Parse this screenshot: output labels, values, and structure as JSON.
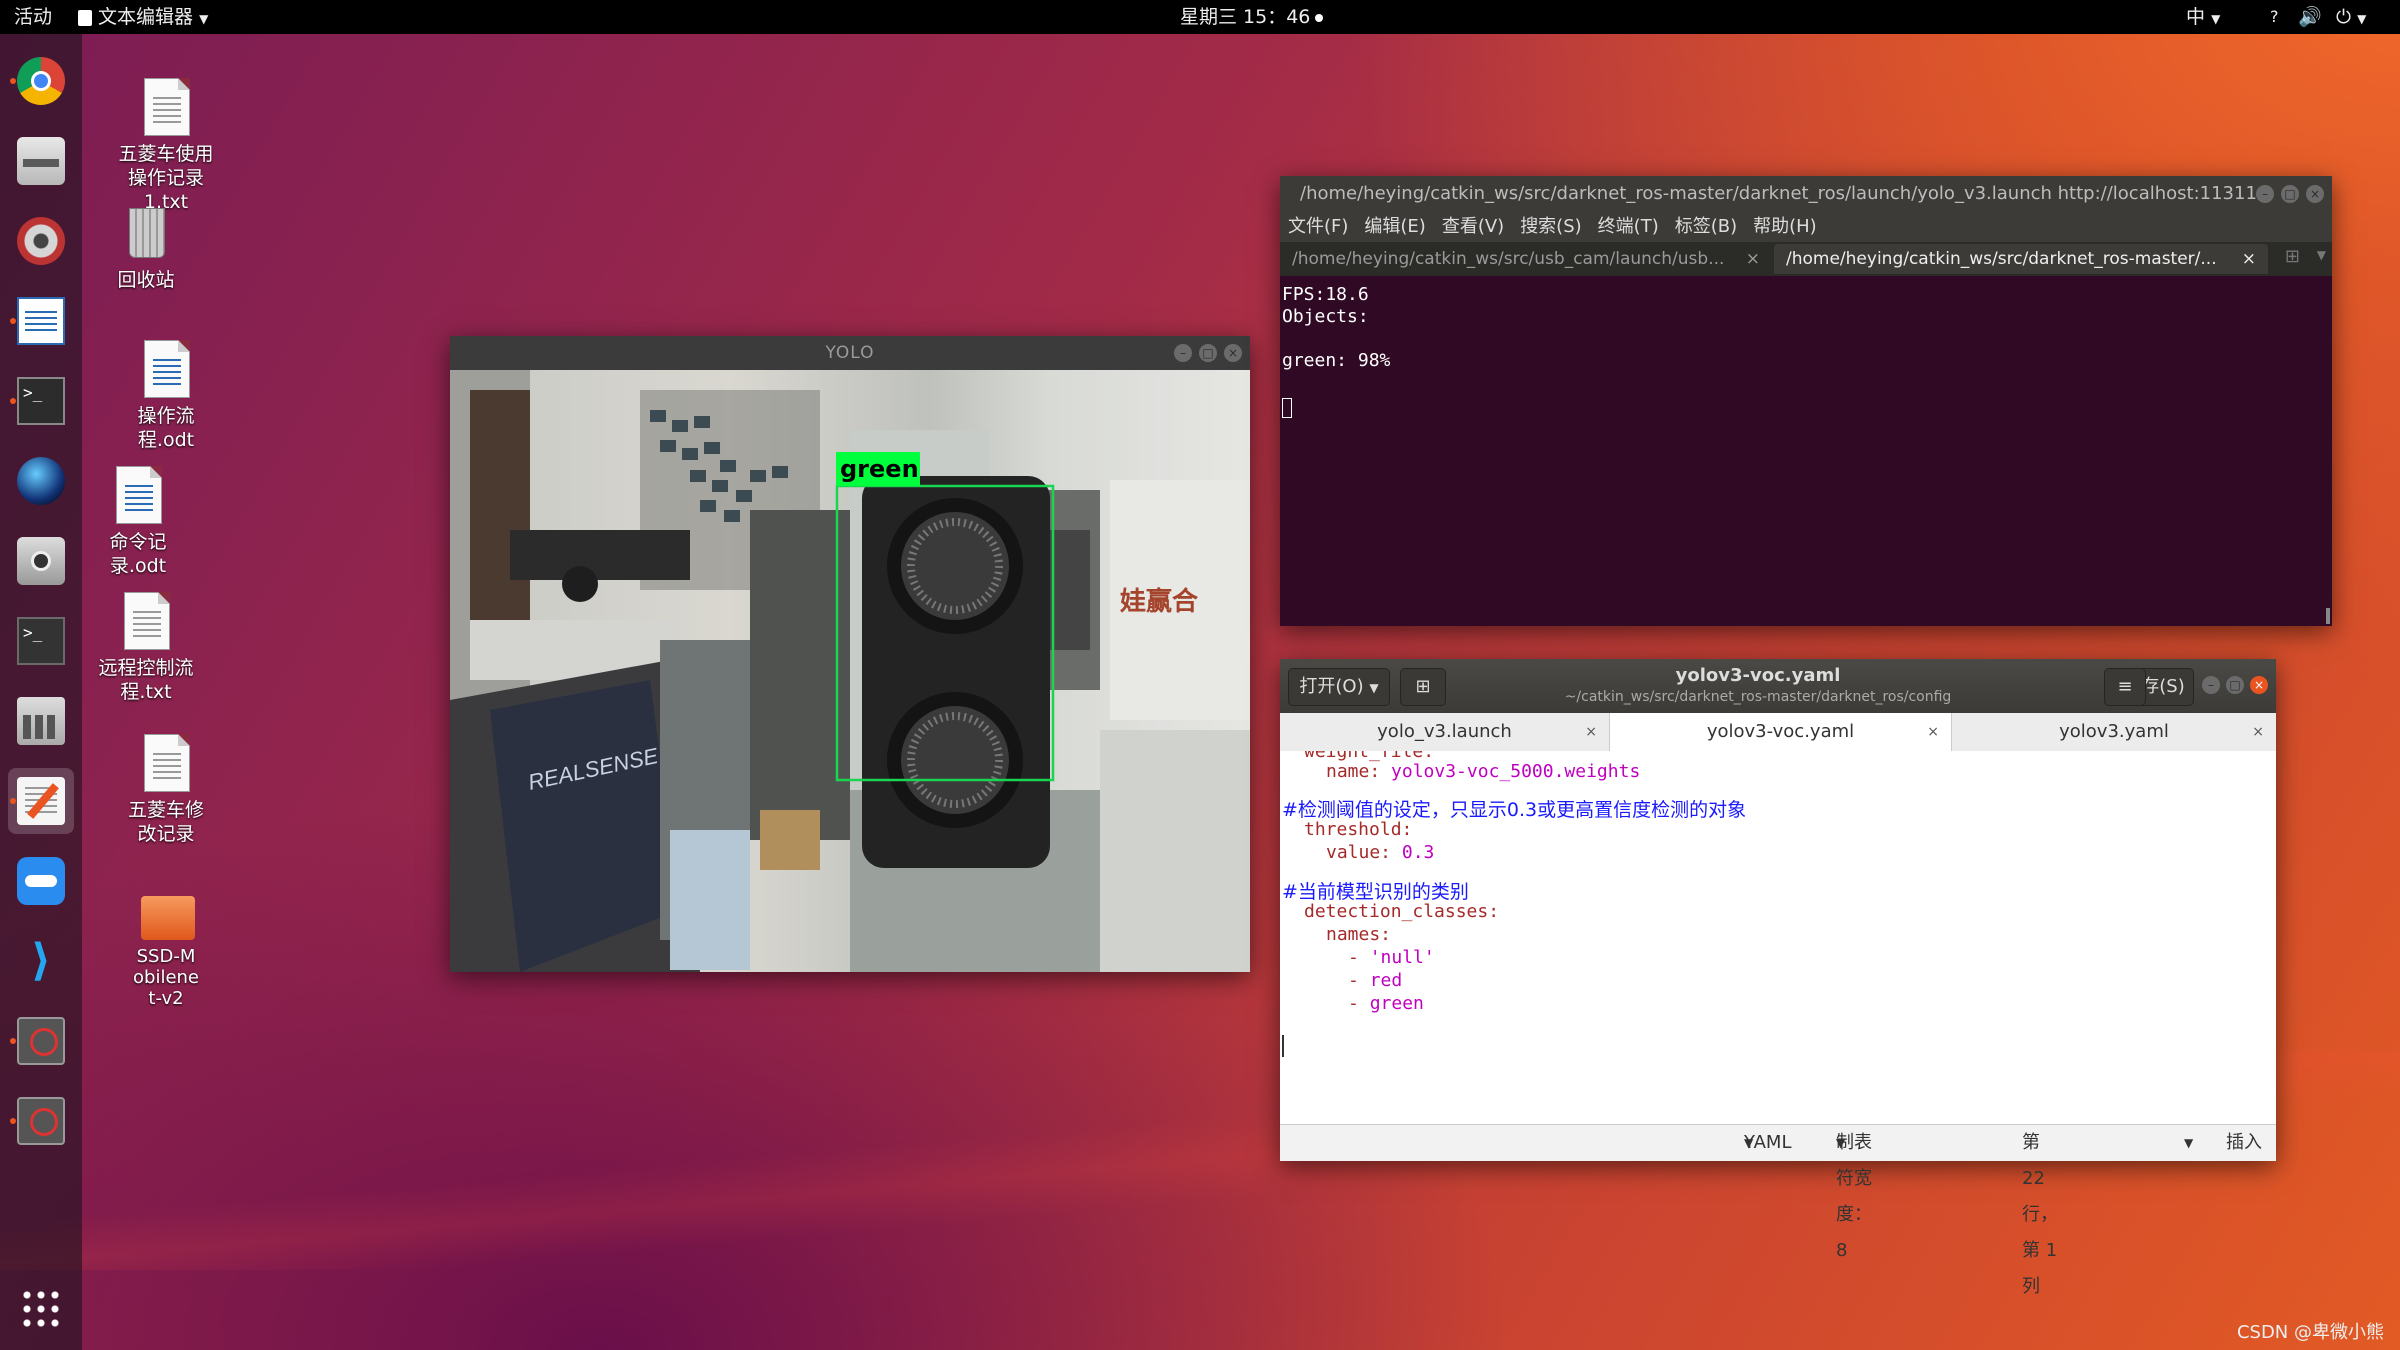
{
  "topbar": {
    "activities": "活动",
    "app_menu": "文本编辑器",
    "clock": "星期三 15：46",
    "input_method": "中",
    "help": "?"
  },
  "desktop_icons": [
    {
      "label": "五菱车使用操作记录1.txt"
    },
    {
      "label": "回收站"
    },
    {
      "label": "操作流程.odt"
    },
    {
      "label": "命令记录.odt"
    },
    {
      "label": "远程控制流程.txt"
    },
    {
      "label": "五菱车修改记录"
    },
    {
      "label": "SSD-Mobilenet-v2"
    }
  ],
  "yolo_window": {
    "title": "YOLO",
    "detection_label": "green"
  },
  "terminal": {
    "title": "/home/heying/catkin_ws/src/darknet_ros-master/darknet_ros/launch/yolo_v3.launch http://localhost:11311",
    "menu": [
      "文件(F)",
      "编辑(E)",
      "查看(V)",
      "搜索(S)",
      "终端(T)",
      "标签(B)",
      "帮助(H)"
    ],
    "tabs": [
      "/home/heying/catkin_ws/src/usb_cam/launch/usb...",
      "/home/heying/catkin_ws/src/darknet_ros-master/..."
    ],
    "output": "FPS:18.6\nObjects:\n\ngreen: 98%"
  },
  "gedit": {
    "open_button": "打开(O)",
    "title": "yolov3-voc.yaml",
    "subtitle": "~/catkin_ws/src/darknet_ros-master/darknet_ros/config",
    "save_button": "保存(S)",
    "tabs": [
      "yolo_v3.launch",
      "yolov3-voc.yaml",
      "yolov3.yaml"
    ],
    "code": {
      "l0": "weight_file:",
      "l1_key": "name:",
      "l1_val": "yolov3-voc_5000.weights",
      "c1": "#检测阈值的设定，只显示0.3或更高置信度检测的对象",
      "l2": "threshold:",
      "l3_key": "value:",
      "l3_val": "0.3",
      "c2": "#当前模型识别的类别",
      "l4": "detection_classes:",
      "l5": "names:",
      "i1": "'null'",
      "i2": "red",
      "i3": "green"
    },
    "status": {
      "lang": "YAML",
      "tab_width": "制表符宽度：8",
      "position": "第 22 行，第 1 列",
      "mode": "插入"
    }
  },
  "watermark": "CSDN @卑微小熊"
}
